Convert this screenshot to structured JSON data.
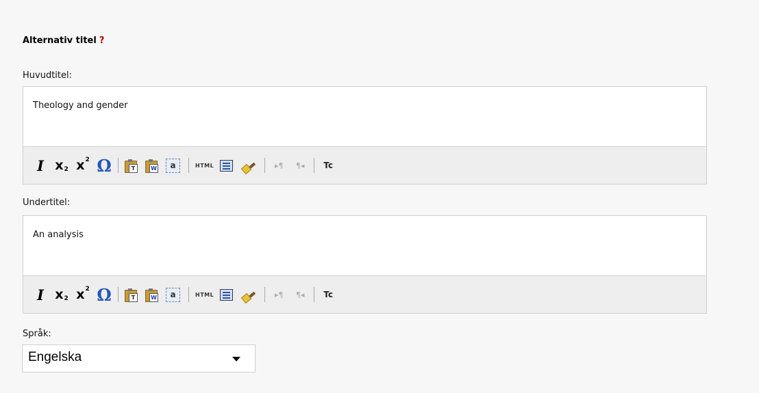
{
  "section": {
    "title": "Alternativ titel",
    "help": "?"
  },
  "main_title": {
    "label": "Huvudtitel:",
    "value": "Theology and gender"
  },
  "subtitle": {
    "label": "Undertitel:",
    "value": "An analysis"
  },
  "toolbar": {
    "italic": "I",
    "subscript_base": "x",
    "subscript_mark": "2",
    "superscript_base": "x",
    "superscript_mark": "2",
    "special_char": "Ω",
    "paste_text": "T",
    "paste_word": "W",
    "select_all": "a",
    "html": "HTML",
    "ltr": "▸¶",
    "rtl": "¶◂",
    "tc": "Tc"
  },
  "language": {
    "label": "Språk:",
    "selected": "Engelska"
  }
}
